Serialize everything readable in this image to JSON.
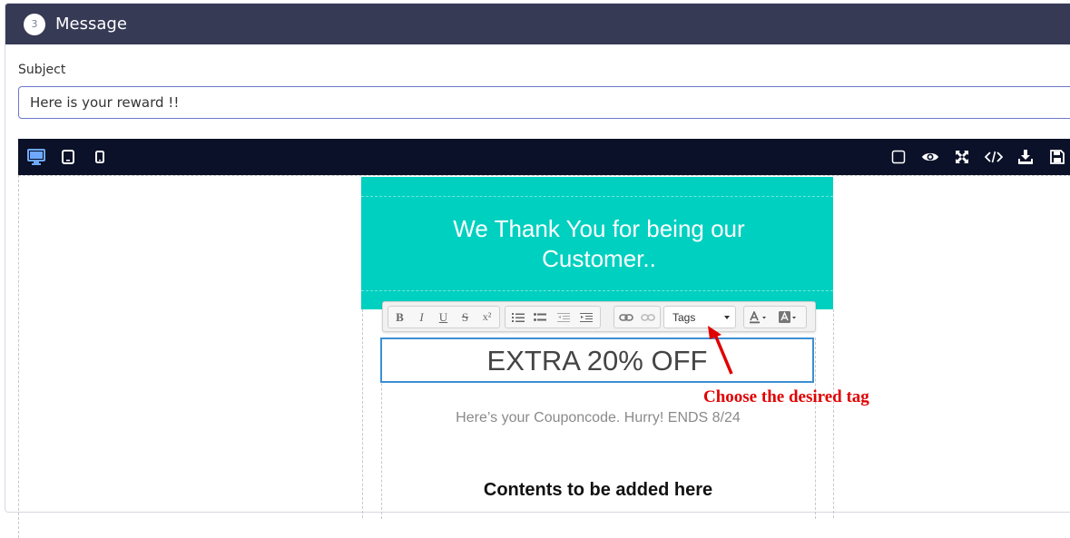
{
  "header": {
    "step_number": "3",
    "title": "Message"
  },
  "subject": {
    "label": "Subject",
    "value": "Here is your reward !!"
  },
  "editor_toolbar": {
    "left_icons": [
      "desktop-icon",
      "tablet-icon",
      "mobile-icon"
    ],
    "right_icons": [
      "square-icon",
      "eye-icon",
      "fullscreen-icon",
      "code-icon",
      "download-icon",
      "save-icon"
    ]
  },
  "email": {
    "banner_text": "We Thank You for being our Customer..",
    "headline": "EXTRA 20% OFF",
    "coupon_text": "Here’s your Couponcode. Hurry! ENDS 8/24",
    "contents_text": "Contents to be added here"
  },
  "rte": {
    "format_buttons": [
      "B",
      "I",
      "U",
      "S",
      "x²"
    ],
    "tags_label": "Tags"
  },
  "annotation": {
    "text": "Choose the desired tag"
  },
  "colors": {
    "header_bg": "#363a55",
    "editor_bar_bg": "#0a1128",
    "banner_bg": "#00d0c0",
    "selection_border": "#3b8fd4",
    "annotation": "#e00000",
    "active_device": "#6ea8ff"
  }
}
